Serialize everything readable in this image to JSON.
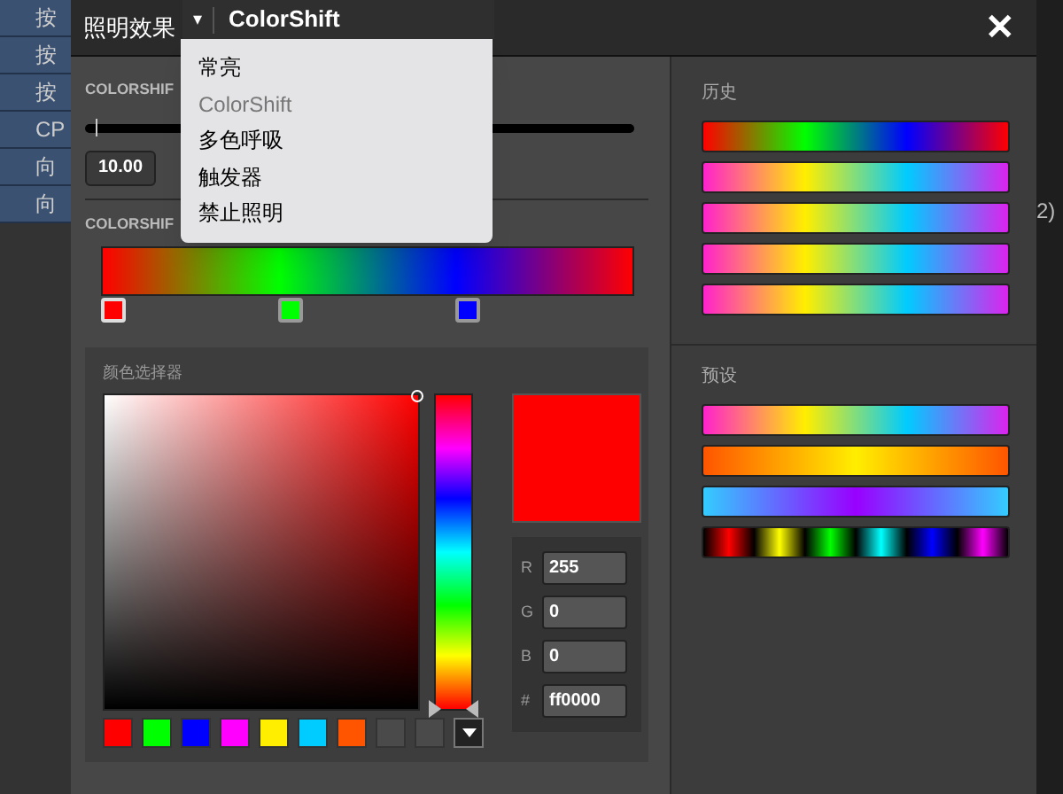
{
  "background_list": [
    {
      "label": "按"
    },
    {
      "label": "按"
    },
    {
      "label": "按"
    },
    {
      "label": "CP"
    },
    {
      "label": "向"
    },
    {
      "label": "向"
    }
  ],
  "background_right": {
    "text": "2)"
  },
  "header": {
    "label": "照明效果",
    "dropdown": {
      "value": "ColorShift",
      "arrow": "▾"
    },
    "close": "✕"
  },
  "menu": [
    {
      "label": "常亮",
      "selected": false
    },
    {
      "label": "ColorShift",
      "selected": true
    },
    {
      "label": "多色呼吸",
      "selected": false
    },
    {
      "label": "触发器",
      "selected": false
    },
    {
      "label": "禁止照明",
      "selected": false
    }
  ],
  "speed": {
    "label": "COLORSHIF",
    "level": 0.02,
    "value": "10.00"
  },
  "gradient": {
    "label": "COLORSHIF",
    "stops": [
      {
        "color": "#ff0000",
        "selected": true
      },
      {
        "color": "#00ff00",
        "selected": false
      },
      {
        "color": "#0000ff",
        "selected": false
      }
    ]
  },
  "picker": {
    "title": "颜色选择器",
    "color": "#ff0000",
    "fields": [
      {
        "label": "R",
        "value": "255"
      },
      {
        "label": "G",
        "value": "0"
      },
      {
        "label": "B",
        "value": "0"
      },
      {
        "label": "#",
        "value": "ff0000"
      }
    ],
    "swatches": [
      {
        "kind": "color",
        "color": "#ff0000"
      },
      {
        "kind": "color",
        "color": "#00ff00"
      },
      {
        "kind": "color",
        "color": "#0000ff"
      },
      {
        "kind": "color",
        "color": "#ff00ff"
      },
      {
        "kind": "color",
        "color": "#ffee00"
      },
      {
        "kind": "color",
        "color": "#00ccff"
      },
      {
        "kind": "color",
        "color": "#ff5500"
      },
      {
        "kind": "empty"
      },
      {
        "kind": "empty"
      }
    ]
  },
  "history": {
    "title": "历史",
    "bars": [
      {
        "kind": "rainbow"
      },
      {
        "kind": "candy"
      },
      {
        "kind": "candy"
      },
      {
        "kind": "candy"
      },
      {
        "kind": "candy"
      }
    ]
  },
  "presets": {
    "title": "预设",
    "bars": [
      {
        "kind": "candy"
      },
      {
        "kind": "sunset"
      },
      {
        "kind": "ocean"
      },
      {
        "kind": "bands"
      }
    ]
  }
}
